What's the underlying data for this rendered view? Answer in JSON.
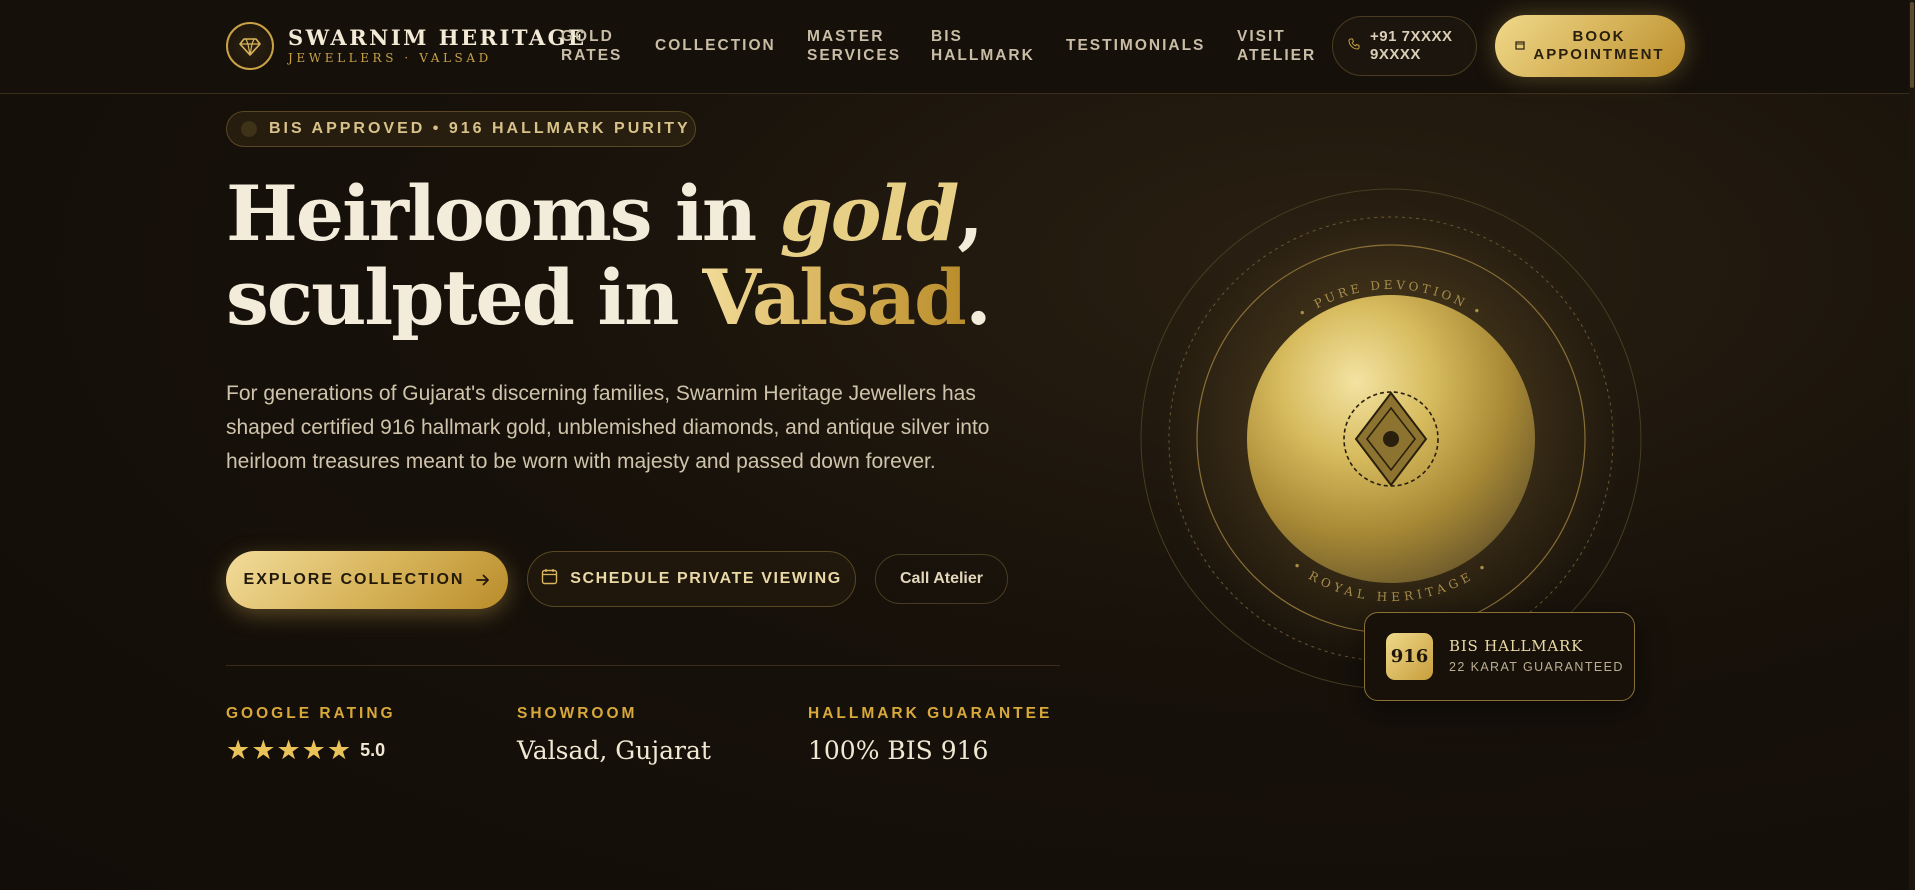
{
  "header": {
    "brand_name": "SWARNIM HERITAGE",
    "brand_sub": "JEWELLERS · VALSAD",
    "nav": [
      {
        "label_line1": "GOLD",
        "label_line2": "RATES"
      },
      {
        "label_line1": "COLLECTION",
        "label_line2": ""
      },
      {
        "label_line1": "MASTER",
        "label_line2": "SERVICES"
      },
      {
        "label_line1": "BIS",
        "label_line2": "HALLMARK"
      },
      {
        "label_line1": "TESTIMONIALS",
        "label_line2": ""
      },
      {
        "label_line1": "VISIT",
        "label_line2": "ATELIER"
      }
    ],
    "phone_line1": "+91 7XXXX",
    "phone_line2": "9XXXX",
    "book_line1": "BOOK",
    "book_line2": "APPOINTMENT"
  },
  "hero": {
    "badge": "BIS APPROVED • 916 HALLMARK PURITY",
    "headline_part1": "Heirlooms in ",
    "headline_italic": "gold",
    "headline_part2": ",",
    "headline_part3": "sculpted in ",
    "headline_gold": "Valsad",
    "headline_part4": ".",
    "lede": "For generations of Gujarat's discerning families, Swarnim Heritage Jewellers has shaped certified 916 hallmark gold, unblemished diamonds, and antique silver into heirloom treasures meant to be worn with majesty and passed down forever.",
    "btn_explore": "EXPLORE COLLECTION",
    "btn_schedule": "SCHEDULE PRIVATE VIEWING",
    "btn_call": "Call Atelier",
    "stats": [
      {
        "label": "GOOGLE RATING",
        "value": "5.0",
        "stars": 5
      },
      {
        "label": "SHOWROOM",
        "value": "Valsad, Gujarat"
      },
      {
        "label": "HALLMARK GUARANTEE",
        "value": "100% BIS 916"
      }
    ]
  },
  "emblem": {
    "top_text": "• PURE DEVOTION •",
    "bottom_text": "• ROYAL HERITAGE •",
    "card_chip": "916",
    "card_title": "BIS HALLMARK",
    "card_sub": "22 KARAT GUARANTEED"
  },
  "colors": {
    "accent_gold": "#d4b055",
    "background": "#15100a",
    "text_light": "#f4ecda",
    "label_gold": "#d8a93a"
  }
}
